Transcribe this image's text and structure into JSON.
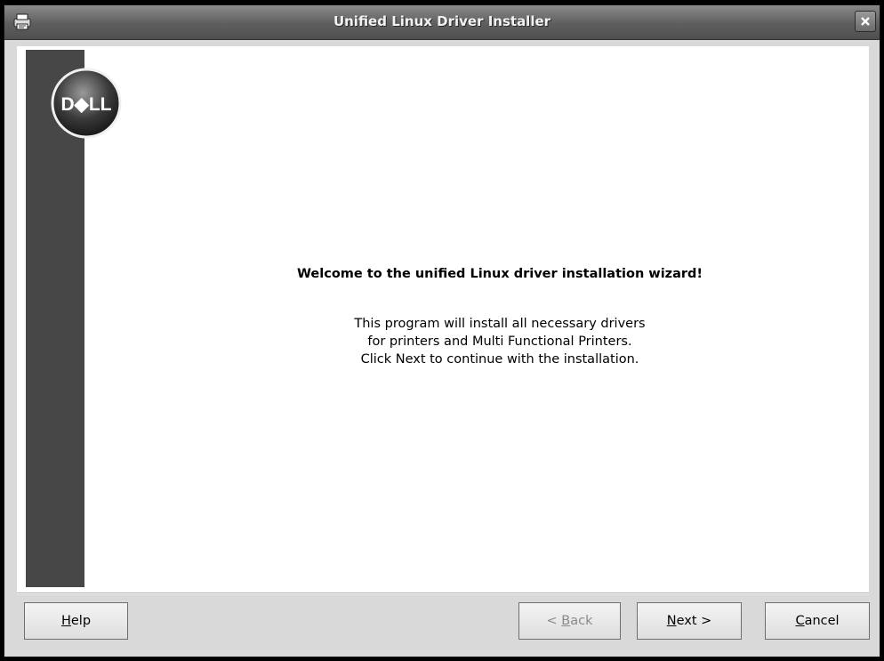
{
  "window": {
    "title": "Unified Linux Driver Installer"
  },
  "logo": {
    "text": "D◆LL"
  },
  "welcome": {
    "heading": "Welcome to the unified Linux driver installation wizard!",
    "line1": "This program will install all necessary drivers",
    "line2": "for printers and Multi Functional Printers.",
    "line3": "Click Next to continue with the installation."
  },
  "buttons": {
    "help_mnemonic": "H",
    "help_rest": "elp",
    "back_prefix": "< ",
    "back_mnemonic": "B",
    "back_rest": "ack",
    "next_mnemonic": "N",
    "next_rest": "ext >",
    "cancel_mnemonic": "C",
    "cancel_rest": "ancel"
  },
  "icons": {
    "app": "printer-icon",
    "close": "close-icon",
    "logo": "dell-logo"
  },
  "colors": {
    "titlebar": "#5e5e5e",
    "sidebar": "#474747",
    "content_bg": "#ffffff"
  }
}
